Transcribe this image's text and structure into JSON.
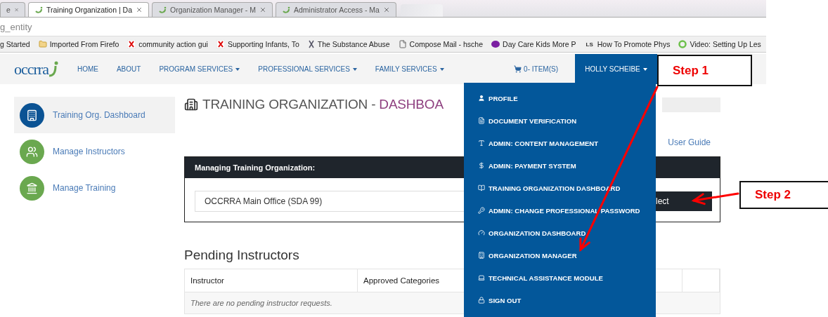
{
  "browser": {
    "tabs": [
      {
        "title": "e",
        "selected": false
      },
      {
        "title": "Training Organization | Da",
        "selected": true
      },
      {
        "title": "Organization Manager - M",
        "selected": false
      },
      {
        "title": "Administrator Access - Ma",
        "selected": false
      }
    ],
    "address": "g_entity",
    "bookmarks": [
      {
        "label": "g Started",
        "kind": "none"
      },
      {
        "label": "Imported From Firefo",
        "kind": "folder"
      },
      {
        "label": "community action gui",
        "kind": "red-mark"
      },
      {
        "label": "Supporting Infants, To",
        "kind": "red-mark"
      },
      {
        "label": "The Substance Abuse",
        "kind": "grey-mark"
      },
      {
        "label": "Compose Mail - hsche",
        "kind": "page"
      },
      {
        "label": "Day Care Kids More P",
        "kind": "purple"
      },
      {
        "label": "How To Promote Phys",
        "kind": "badge",
        "badge": "LS"
      },
      {
        "label": "Video: Setting Up Les",
        "kind": "green-e"
      }
    ]
  },
  "nav": {
    "logo": "occrra",
    "items": [
      {
        "label": "HOME",
        "dropdown": false
      },
      {
        "label": "ABOUT",
        "dropdown": false
      },
      {
        "label": "PROGRAM SERVICES",
        "dropdown": true
      },
      {
        "label": "PROFESSIONAL SERVICES",
        "dropdown": true
      },
      {
        "label": "FAMILY SERVICES",
        "dropdown": true
      }
    ],
    "cart": "0- ITEM(S)",
    "user": {
      "name": "HOLLY SCHEIBE",
      "expanded": true,
      "menu": [
        {
          "label": "PROFILE",
          "kind": "user"
        },
        {
          "label": "DOCUMENT VERIFICATION",
          "kind": "document"
        },
        {
          "label": "ADMIN: CONTENT MANAGEMENT",
          "kind": "text"
        },
        {
          "label": "ADMIN: PAYMENT SYSTEM",
          "kind": "dollar"
        },
        {
          "label": "TRAINING ORGANIZATION DASHBOARD",
          "kind": "book"
        },
        {
          "label": "ADMIN: CHANGE PROFESSIONAL PASSWORD",
          "kind": "key"
        },
        {
          "label": "ORGANIZATION DASHBOARD",
          "kind": "gauge"
        },
        {
          "label": "ORGANIZATION MANAGER",
          "kind": "building"
        },
        {
          "label": "TECHNICAL ASSISTANCE MODULE",
          "kind": "laptop"
        },
        {
          "label": "SIGN OUT",
          "kind": "lock"
        }
      ]
    }
  },
  "sidebar": {
    "items": [
      {
        "label": "Training Org. Dashboard",
        "kind": "building",
        "color": "#0b5394",
        "selected": true
      },
      {
        "label": "Manage Instructors",
        "kind": "people",
        "color": "#6aa84f",
        "selected": false
      },
      {
        "label": "Manage Training",
        "kind": "landmark",
        "color": "#6aa84f",
        "selected": false
      }
    ]
  },
  "page": {
    "title": "TRAINING ORGANIZATION - ",
    "title_accent": "DASHBOA",
    "user_guide": "User Guide",
    "panel": {
      "header": "Managing Training Organization:",
      "select_value": "OCCRRA Main Office (SDA 99)",
      "button": "lect"
    },
    "pending": {
      "heading": "Pending Instructors",
      "columns": [
        "Instructor",
        "Approved Categories"
      ],
      "empty_message": "There are no pending instructor requests."
    }
  },
  "annotations": [
    {
      "label": "Step 1"
    },
    {
      "label": "Step 2"
    }
  ]
}
